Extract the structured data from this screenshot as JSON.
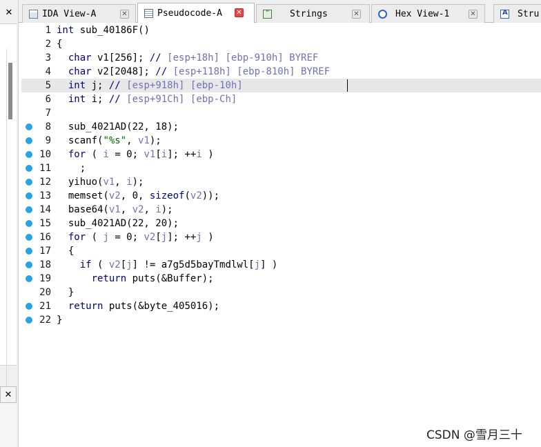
{
  "left_panel": {
    "close_top": "✕",
    "close_bottom": "✕"
  },
  "tabs": [
    {
      "label": "IDA View-A",
      "icon": "ida-view-icon",
      "close": "✕"
    },
    {
      "label": "Pseudocode-A",
      "icon": "pseudocode-icon",
      "close": "✕"
    },
    {
      "label": "Strings",
      "icon": "strings-icon",
      "close": "✕"
    },
    {
      "label": "Hex View-1",
      "icon": "hex-view-icon",
      "close": "✕"
    },
    {
      "label": "Stru",
      "icon": "structures-icon"
    }
  ],
  "code_lines": [
    {
      "n": "1",
      "bp": false,
      "t": "int sub_40186F()"
    },
    {
      "n": "2",
      "bp": false,
      "t": "{"
    },
    {
      "n": "3",
      "bp": false,
      "t": "  char v1[256]; // [esp+18h] [ebp-910h] BYREF"
    },
    {
      "n": "4",
      "bp": false,
      "t": "  char v2[2048]; // [esp+118h] [ebp-810h] BYREF"
    },
    {
      "n": "5",
      "bp": false,
      "t": "  int j; // [esp+918h] [ebp-10h]"
    },
    {
      "n": "6",
      "bp": false,
      "t": "  int i; // [esp+91Ch] [ebp-Ch]"
    },
    {
      "n": "7",
      "bp": false,
      "t": ""
    },
    {
      "n": "8",
      "bp": true,
      "t": "  sub_4021AD(22, 18);"
    },
    {
      "n": "9",
      "bp": true,
      "t": "  scanf(\"%s\", v1);"
    },
    {
      "n": "10",
      "bp": true,
      "t": "  for ( i = 0; v1[i]; ++i )"
    },
    {
      "n": "11",
      "bp": true,
      "t": "    ;"
    },
    {
      "n": "12",
      "bp": true,
      "t": "  yihuo(v1, i);"
    },
    {
      "n": "13",
      "bp": true,
      "t": "  memset(v2, 0, sizeof(v2));"
    },
    {
      "n": "14",
      "bp": true,
      "t": "  base64(v1, v2, i);"
    },
    {
      "n": "15",
      "bp": true,
      "t": "  sub_4021AD(22, 20);"
    },
    {
      "n": "16",
      "bp": true,
      "t": "  for ( j = 0; v2[j]; ++j )"
    },
    {
      "n": "17",
      "bp": true,
      "t": "  {"
    },
    {
      "n": "18",
      "bp": true,
      "t": "    if ( v2[j] != a7g5d5bayTmdlwl[j] )"
    },
    {
      "n": "19",
      "bp": true,
      "t": "      return puts(&Buffer);"
    },
    {
      "n": "20",
      "bp": false,
      "t": "  }"
    },
    {
      "n": "21",
      "bp": true,
      "t": "  return puts(&byte_405016);"
    },
    {
      "n": "22",
      "bp": true,
      "t": "}"
    }
  ],
  "highlighted_line": 5,
  "watermark": "CSDN @雪月三十",
  "colors": {
    "breakpoint": "#29a3e6",
    "keyword": "#00007f",
    "variable": "#7070b8",
    "string": "#006400"
  }
}
